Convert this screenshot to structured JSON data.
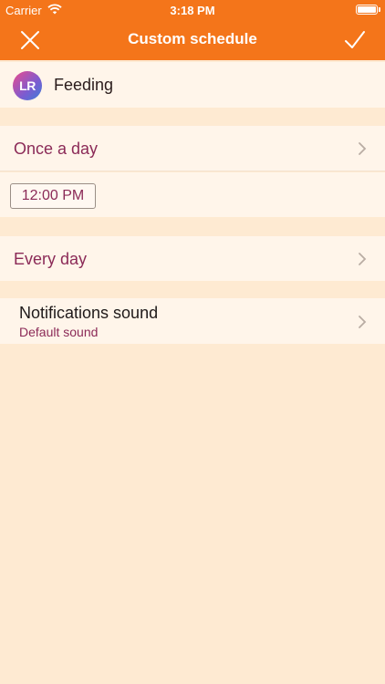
{
  "status_bar": {
    "carrier": "Carrier",
    "time": "3:18 PM"
  },
  "navbar": {
    "title": "Custom schedule",
    "close_icon": "close-icon",
    "confirm_icon": "checkmark-icon"
  },
  "entry": {
    "avatar_initials": "LR",
    "label": "Feeding"
  },
  "frequency": {
    "label": "Once a day"
  },
  "time_slot": {
    "value": "12:00 PM"
  },
  "repeat": {
    "label": "Every day"
  },
  "notifications": {
    "title": "Notifications sound",
    "subtitle": "Default sound"
  },
  "colors": {
    "header": "#f4751a",
    "background": "#feead2",
    "row": "#fff5ea",
    "accent_text": "#8b2a57"
  }
}
